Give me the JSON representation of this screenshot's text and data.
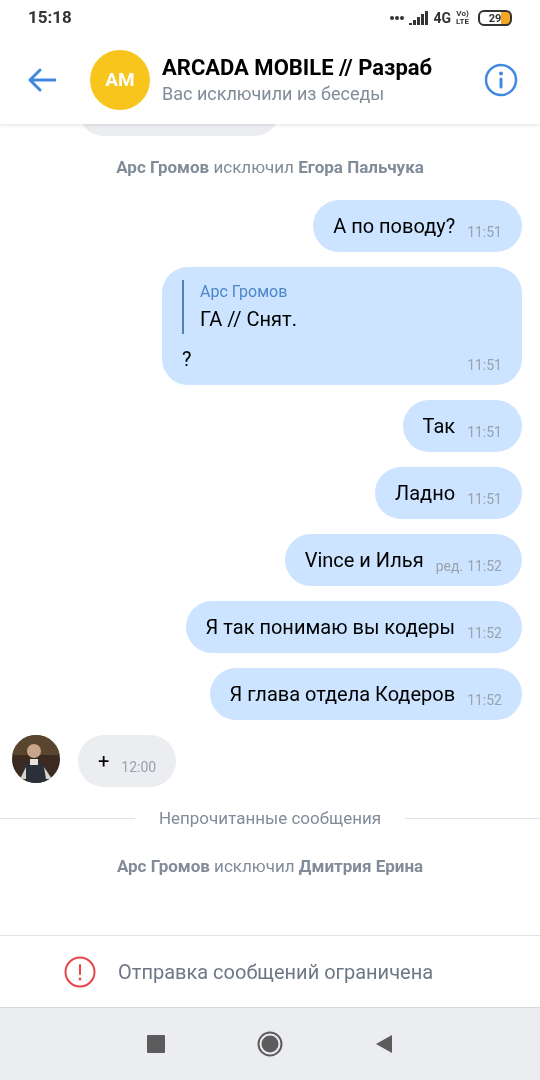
{
  "status_bar": {
    "time": "15:18",
    "network": "4G",
    "volte": "Vo)\nLTE",
    "battery": "29"
  },
  "header": {
    "avatar_initials": "AM",
    "title": "ARCADA MOBILE // Разраб",
    "subtitle": "Вас исключили из беседы"
  },
  "messages": [
    {
      "kind": "cut"
    },
    {
      "kind": "service",
      "text": "**Арс Громов** исключил **Егора Пальчука**"
    },
    {
      "kind": "out",
      "text": "А по поводу?",
      "time": "11:51"
    },
    {
      "kind": "out",
      "reply_author": "Арс Громов",
      "reply_text": "ГА // Снят.",
      "text": "?",
      "time": "11:51"
    },
    {
      "kind": "out",
      "text": "Так",
      "time": "11:51"
    },
    {
      "kind": "out",
      "text": "Ладно",
      "time": "11:51"
    },
    {
      "kind": "out",
      "text": "Vince и Илья",
      "edited": "ред.",
      "time": "11:52"
    },
    {
      "kind": "out",
      "text": "Я так понимаю вы кодеры",
      "time": "11:52"
    },
    {
      "kind": "out",
      "text": "Я глава отдела Кодеров",
      "time": "11:52"
    },
    {
      "kind": "in",
      "text": "+",
      "time": "12:00"
    },
    {
      "kind": "divider",
      "text": "Непрочитанные сообщения"
    },
    {
      "kind": "service",
      "text": "**Арс Громов** исключил **Дмитрия Ерина**"
    }
  ],
  "restricted": {
    "text": "Отправка сообщений ограничена"
  }
}
